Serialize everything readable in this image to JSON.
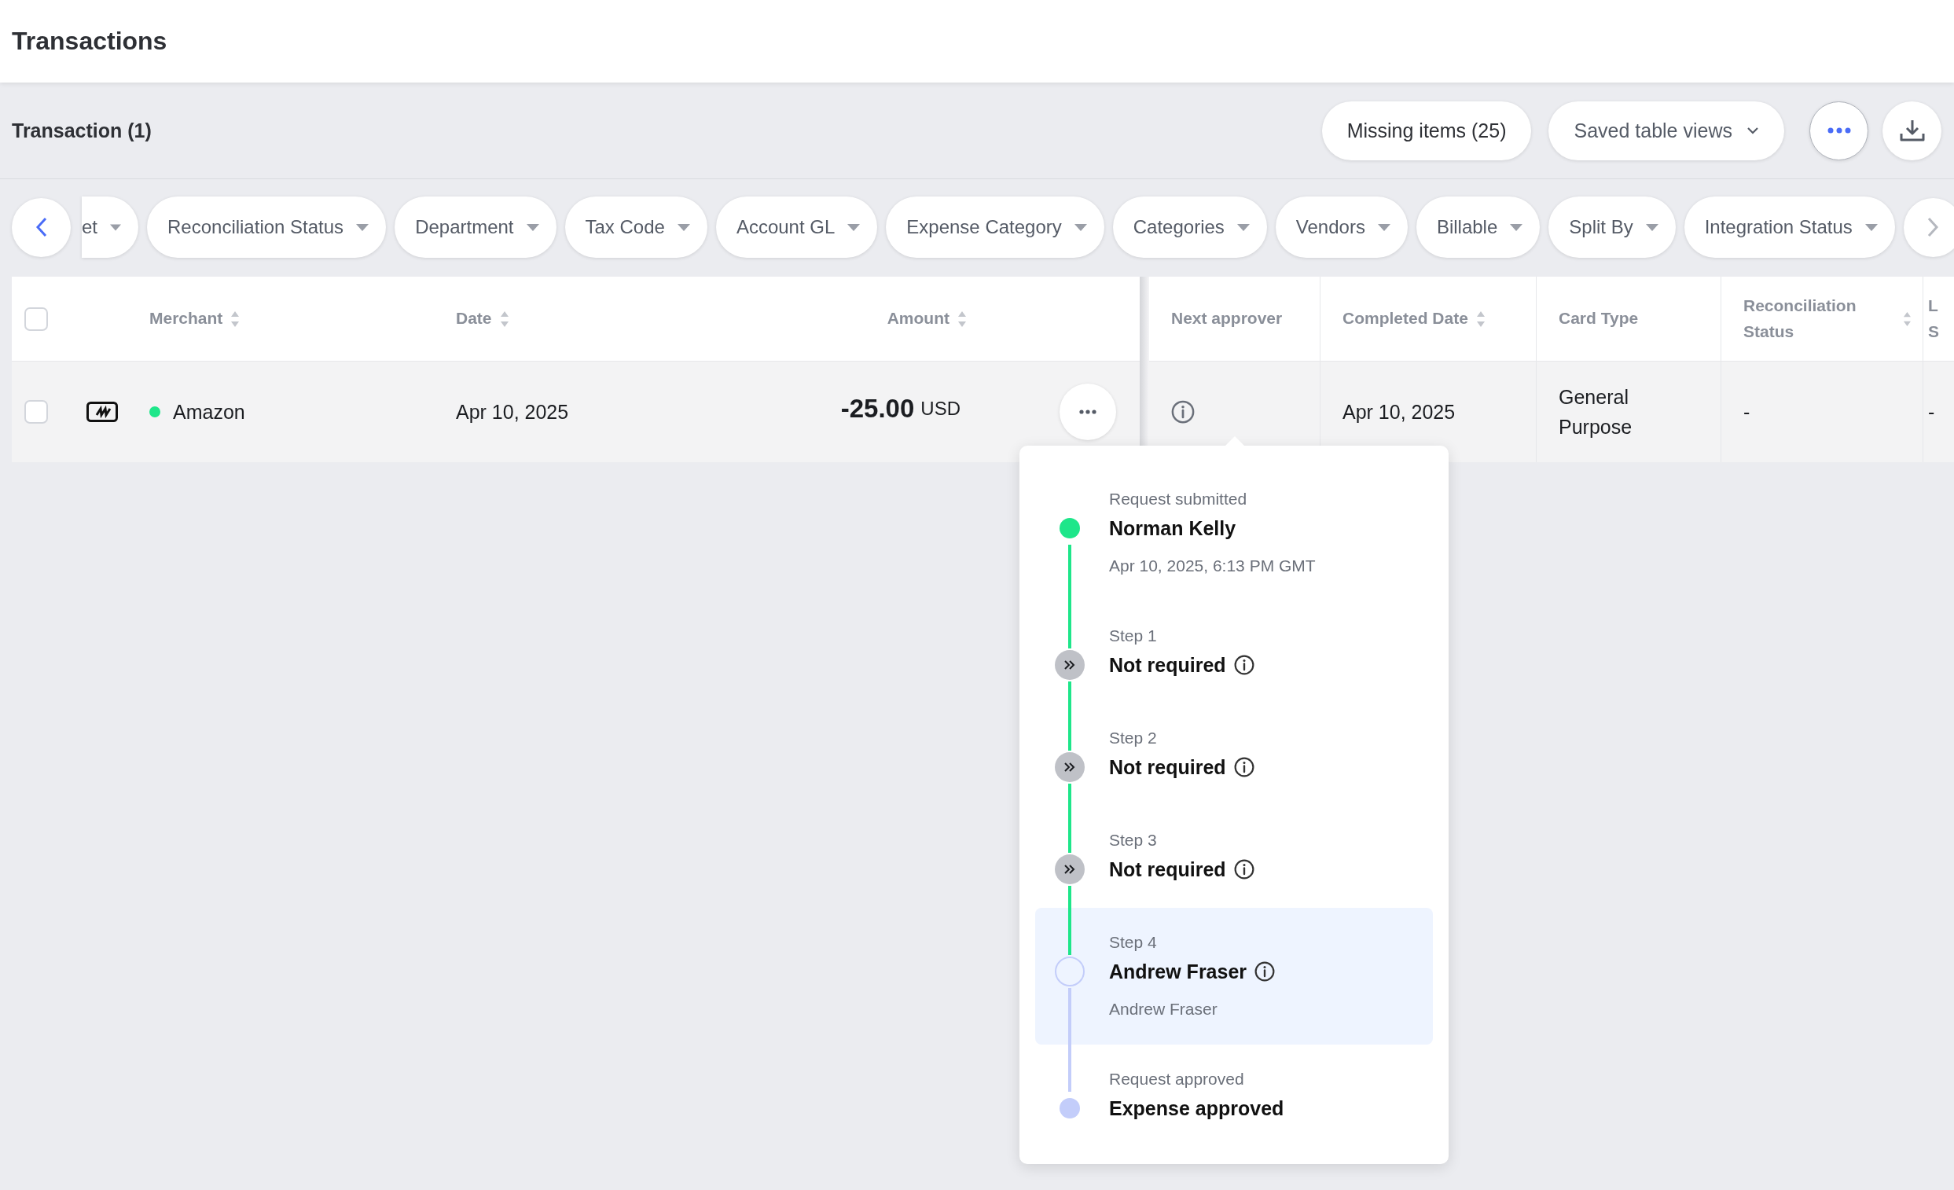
{
  "header": {
    "title": "Transactions"
  },
  "toolbar": {
    "count": "Transaction (1)",
    "missing_items": "Missing items (25)",
    "saved_views": "Saved table views"
  },
  "filters": [
    {
      "label": "et",
      "partial": true
    },
    {
      "label": "Reconciliation Status",
      "partial": false
    },
    {
      "label": "Department",
      "partial": false
    },
    {
      "label": "Tax Code",
      "partial": false
    },
    {
      "label": "Account GL",
      "partial": false
    },
    {
      "label": "Expense Category",
      "partial": false
    },
    {
      "label": "Categories",
      "partial": false
    },
    {
      "label": "Vendors",
      "partial": false
    },
    {
      "label": "Billable",
      "partial": false
    },
    {
      "label": "Split By",
      "partial": false
    },
    {
      "label": "Integration Status",
      "partial": false
    }
  ],
  "table": {
    "select_all": {
      "checked": false
    },
    "columns": [
      {
        "label": "Merchant",
        "sortable": true
      },
      {
        "label": "Date",
        "sortable": true
      },
      {
        "label": "Amount",
        "sortable": true
      },
      {
        "label": "Next approver",
        "sortable": false
      },
      {
        "label": "Completed Date",
        "sortable": true
      },
      {
        "label": "Card Type",
        "sortable": false
      },
      {
        "label": "Reconciliation Status",
        "sortable": true
      },
      {
        "label": "L S",
        "sortable": false
      }
    ],
    "rows": [
      {
        "checked": false,
        "color": "#1ee68a",
        "merchant": "Amazon",
        "date": "Apr 10, 2025",
        "amount": "-25.00",
        "currency": "USD",
        "completed_date": "Apr 10, 2025",
        "card_type": "General Purpose",
        "reconciliation_status": "-",
        "column_8": "-"
      }
    ]
  },
  "approval_popup": {
    "steps": [
      {
        "kind": "submitted",
        "caption": "Request submitted",
        "title": "Norman Kelly",
        "info": false,
        "detail": "Apr 10, 2025, 6:13 PM GMT"
      },
      {
        "kind": "skipped",
        "caption": "Step 1",
        "title": "Not required",
        "info": true
      },
      {
        "kind": "skipped",
        "caption": "Step 2",
        "title": "Not required",
        "info": true
      },
      {
        "kind": "skipped",
        "caption": "Step 3",
        "title": "Not required",
        "info": true
      },
      {
        "kind": "current",
        "caption": "Step 4",
        "title": "Andrew Fraser",
        "info": true,
        "detail": "Andrew Fraser"
      },
      {
        "kind": "final",
        "caption": "Request approved",
        "title": "Expense approved",
        "info": false
      }
    ]
  }
}
